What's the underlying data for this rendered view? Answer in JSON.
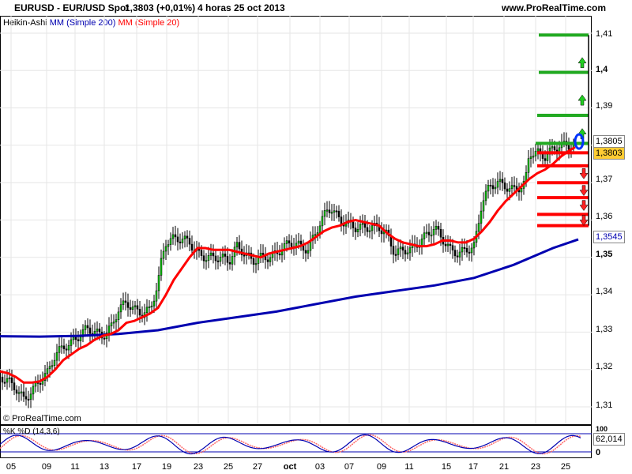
{
  "header": {
    "symbol": "EURUSD - EUR/USD Spot",
    "price_change": "1,3803 (+0,01%)",
    "timeframe_date": "4 horas  25 oct 2013",
    "brand": "www.ProRealTime.com",
    "indicators_label": "Heikin-Ashi",
    "ma200_label": "MM (Simple 200)",
    "ma20_label": "MM (Simple 20)"
  },
  "colors": {
    "bull_candle": "#00cc00",
    "bear_candle": "#000000",
    "ma20": "#ff0000",
    "ma200": "#0000b0",
    "green_level": "#22aa22",
    "red_level": "#ff0000",
    "price_box": "#ffcc33"
  },
  "price_boxes": {
    "last_high": "1,3805",
    "last_close": "1,3803",
    "ma200_value": "1,3545"
  },
  "copyright": "© ProRealTime.com",
  "stochastic": {
    "label": "%K %D (14,3,6)",
    "top_tick": "100",
    "value": "62,014",
    "bottom_tick": "0"
  },
  "chart_data": {
    "type": "candlestick",
    "title": "EURUSD - EUR/USD Spot",
    "y_ticks": [
      "1,41",
      "1,4",
      "1,39",
      "1,38",
      "1,37",
      "1,36",
      "1,35",
      "1,34",
      "1,33",
      "1,32",
      "1,31"
    ],
    "ylim": [
      1.3075,
      1.4175
    ],
    "x_ticks": [
      "05",
      "09",
      "11",
      "13",
      "17",
      "19",
      "23",
      "25",
      "27",
      "oct",
      "03",
      "07",
      "09",
      "11",
      "15",
      "17",
      "21",
      "23",
      "25"
    ],
    "close_series": [
      [
        0,
        1.318
      ],
      [
        10,
        1.317
      ],
      [
        20,
        1.315
      ],
      [
        30,
        1.312
      ],
      [
        40,
        1.314
      ],
      [
        50,
        1.317
      ],
      [
        60,
        1.319
      ],
      [
        70,
        1.324
      ],
      [
        80,
        1.326
      ],
      [
        90,
        1.327
      ],
      [
        100,
        1.329
      ],
      [
        110,
        1.331
      ],
      [
        120,
        1.33
      ],
      [
        130,
        1.329
      ],
      [
        140,
        1.331
      ],
      [
        150,
        1.336
      ],
      [
        160,
        1.338
      ],
      [
        170,
        1.336
      ],
      [
        180,
        1.335
      ],
      [
        190,
        1.336
      ],
      [
        200,
        1.343
      ],
      [
        205,
        1.35
      ],
      [
        210,
        1.354
      ],
      [
        220,
        1.355
      ],
      [
        230,
        1.355
      ],
      [
        240,
        1.354
      ],
      [
        250,
        1.351
      ],
      [
        260,
        1.35
      ],
      [
        270,
        1.35
      ],
      [
        280,
        1.35
      ],
      [
        290,
        1.349
      ],
      [
        300,
        1.353
      ],
      [
        310,
        1.351
      ],
      [
        320,
        1.349
      ],
      [
        330,
        1.35
      ],
      [
        340,
        1.35
      ],
      [
        350,
        1.351
      ],
      [
        360,
        1.353
      ],
      [
        370,
        1.354
      ],
      [
        380,
        1.353
      ],
      [
        390,
        1.352
      ],
      [
        400,
        1.357
      ],
      [
        410,
        1.361
      ],
      [
        415,
        1.363
      ],
      [
        420,
        1.363
      ],
      [
        430,
        1.36
      ],
      [
        440,
        1.359
      ],
      [
        450,
        1.358
      ],
      [
        460,
        1.358
      ],
      [
        470,
        1.358
      ],
      [
        480,
        1.358
      ],
      [
        490,
        1.356
      ],
      [
        500,
        1.351
      ],
      [
        510,
        1.352
      ],
      [
        520,
        1.352
      ],
      [
        530,
        1.354
      ],
      [
        540,
        1.356
      ],
      [
        550,
        1.358
      ],
      [
        560,
        1.355
      ],
      [
        570,
        1.352
      ],
      [
        580,
        1.351
      ],
      [
        590,
        1.352
      ],
      [
        600,
        1.353
      ],
      [
        605,
        1.358
      ],
      [
        610,
        1.365
      ],
      [
        620,
        1.369
      ],
      [
        630,
        1.37
      ],
      [
        640,
        1.369
      ],
      [
        650,
        1.368
      ],
      [
        660,
        1.369
      ],
      [
        665,
        1.37
      ],
      [
        670,
        1.378
      ],
      [
        680,
        1.378
      ],
      [
        690,
        1.377
      ],
      [
        700,
        1.379
      ],
      [
        710,
        1.38
      ],
      [
        720,
        1.38
      ],
      [
        728,
        1.38
      ]
    ],
    "ma20": [
      [
        0,
        1.3195
      ],
      [
        10,
        1.319
      ],
      [
        20,
        1.318
      ],
      [
        30,
        1.3165
      ],
      [
        40,
        1.3165
      ],
      [
        50,
        1.3168
      ],
      [
        60,
        1.318
      ],
      [
        70,
        1.32
      ],
      [
        80,
        1.3225
      ],
      [
        90,
        1.324
      ],
      [
        100,
        1.3255
      ],
      [
        110,
        1.3265
      ],
      [
        120,
        1.328
      ],
      [
        130,
        1.329
      ],
      [
        140,
        1.3295
      ],
      [
        150,
        1.3305
      ],
      [
        160,
        1.3325
      ],
      [
        170,
        1.333
      ],
      [
        180,
        1.334
      ],
      [
        190,
        1.335
      ],
      [
        200,
        1.3365
      ],
      [
        210,
        1.34
      ],
      [
        220,
        1.344
      ],
      [
        230,
        1.347
      ],
      [
        240,
        1.35
      ],
      [
        250,
        1.3525
      ],
      [
        260,
        1.3525
      ],
      [
        270,
        1.352
      ],
      [
        280,
        1.352
      ],
      [
        290,
        1.352
      ],
      [
        300,
        1.3515
      ],
      [
        310,
        1.351
      ],
      [
        320,
        1.3505
      ],
      [
        330,
        1.35
      ],
      [
        340,
        1.351
      ],
      [
        350,
        1.3515
      ],
      [
        360,
        1.352
      ],
      [
        370,
        1.3525
      ],
      [
        380,
        1.353
      ],
      [
        390,
        1.354
      ],
      [
        400,
        1.3555
      ],
      [
        410,
        1.357
      ],
      [
        420,
        1.358
      ],
      [
        430,
        1.3585
      ],
      [
        440,
        1.3595
      ],
      [
        450,
        1.36
      ],
      [
        460,
        1.3595
      ],
      [
        470,
        1.359
      ],
      [
        480,
        1.3585
      ],
      [
        490,
        1.3565
      ],
      [
        500,
        1.355
      ],
      [
        510,
        1.354
      ],
      [
        520,
        1.3535
      ],
      [
        530,
        1.353
      ],
      [
        540,
        1.353
      ],
      [
        550,
        1.3535
      ],
      [
        560,
        1.3545
      ],
      [
        570,
        1.3545
      ],
      [
        580,
        1.354
      ],
      [
        590,
        1.354
      ],
      [
        600,
        1.355
      ],
      [
        610,
        1.357
      ],
      [
        620,
        1.3595
      ],
      [
        630,
        1.3625
      ],
      [
        640,
        1.365
      ],
      [
        650,
        1.367
      ],
      [
        660,
        1.369
      ],
      [
        670,
        1.371
      ],
      [
        680,
        1.3725
      ],
      [
        690,
        1.3735
      ],
      [
        700,
        1.375
      ],
      [
        710,
        1.377
      ],
      [
        720,
        1.3785
      ],
      [
        728,
        1.3795
      ]
    ],
    "ma200": [
      [
        0,
        1.3289
      ],
      [
        50,
        1.3288
      ],
      [
        100,
        1.329
      ],
      [
        150,
        1.3295
      ],
      [
        200,
        1.3305
      ],
      [
        250,
        1.3325
      ],
      [
        300,
        1.334
      ],
      [
        350,
        1.3355
      ],
      [
        400,
        1.3375
      ],
      [
        450,
        1.3395
      ],
      [
        500,
        1.341
      ],
      [
        550,
        1.3425
      ],
      [
        600,
        1.3445
      ],
      [
        650,
        1.348
      ],
      [
        700,
        1.3525
      ],
      [
        732,
        1.3548
      ]
    ],
    "resistance_levels": [
      1.3805,
      1.388,
      1.3995,
      1.4095
    ],
    "support_levels": [
      1.378,
      1.3745,
      1.37,
      1.366,
      1.3615,
      1.3585
    ],
    "stoch_ylim": [
      0,
      100
    ]
  }
}
